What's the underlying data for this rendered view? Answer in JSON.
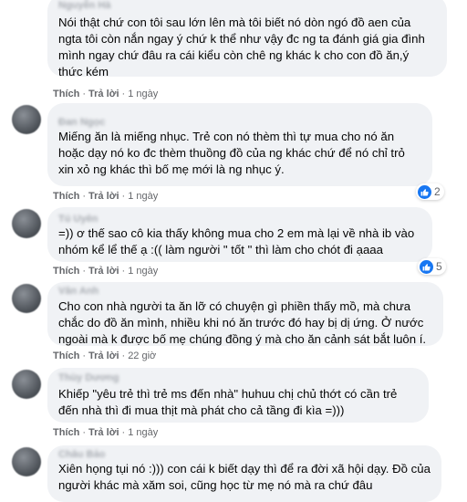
{
  "actions": {
    "like": "Thích",
    "reply": "Trả lời",
    "sep": "·"
  },
  "comments": [
    {
      "author": "Nguyễn Hà",
      "text": "Nói thật chứ con tôi sau lớn lên mà tôi biết nó dòn ngó đồ aen của ngta tôi còn nắn ngay ý chứ k thể như vậy đc ng ta đánh giá gia đình mình ngay chứ đâu ra cái kiểu còn chê ng khác k cho con đồ ăn,ý thức kém",
      "time": "1 ngày",
      "reactions": ""
    },
    {
      "author": "Đan Ngọc",
      "text": "Miếng ăn là miếng nhục. Trẻ con nó thèm thì tự mua cho nó ăn hoặc dạy nó ko đc thèm thuồng đồ của ng khác chứ để nó chỉ trỏ xin xỏ ng khác thì bố mẹ mới là ng nhục ý.",
      "time": "1 ngày",
      "reactions": "2"
    },
    {
      "author": "Tú Uyên",
      "text": "=)) ơ thế sao cô kia thấy không mua cho 2 em mà lại về nhà ib vào nhóm kể lể thế ạ :(( làm người \" tốt \" thì làm cho chót đi ạaaa",
      "time": "1 ngày",
      "reactions": "5"
    },
    {
      "author": "Vân Anh",
      "text": "Cho con nhà người ta ăn lỡ có chuyện gì phiền thấy mồ, mà chưa chắc do đồ ăn mình, nhiều khi nó ăn trước đó hay bị dị ứng. Ở nước ngoài mà k được bố mẹ chúng đồng ý mà cho ăn cảnh sát bắt luôn í.",
      "time": "22 giờ",
      "reactions": ""
    },
    {
      "author": "Thùy Dương",
      "text": "Khiếp \"yêu trẻ thì trẻ ms đến nhà\" huhuu chị chủ thớt có cần trẻ đến nhà thì đi mua thịt mà phát cho cả tầng đi kìa =)))",
      "time": "1 ngày",
      "reactions": ""
    },
    {
      "author": "Châu Bảo",
      "text": "Xiên họng tụi nó :))) con cái k biết dạy thì để ra đời xã hội dạy. Đồ của người khác mà xăm soi, cũng học từ mẹ nó mà ra chứ đâu",
      "time": "",
      "reactions": ""
    }
  ]
}
